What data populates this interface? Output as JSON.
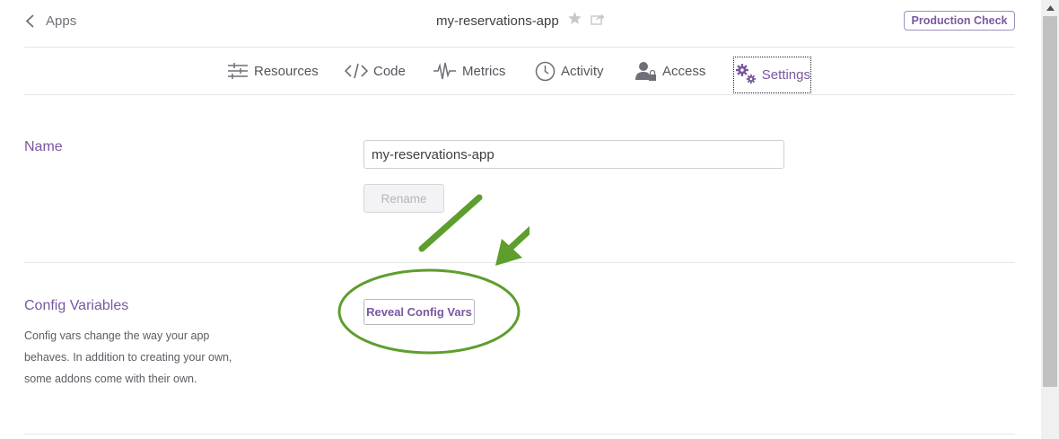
{
  "header": {
    "back_label": "Apps",
    "app_title": "my-reservations-app",
    "star_icon": "star-icon",
    "share_icon": "share-icon",
    "production_check_label": "Production Check"
  },
  "tabs": [
    {
      "label": "Resources",
      "icon": "resources-sliders-icon"
    },
    {
      "label": "Code",
      "icon": "code-icon"
    },
    {
      "label": "Metrics",
      "icon": "metrics-pulse-icon"
    },
    {
      "label": "Activity",
      "icon": "clock-icon"
    },
    {
      "label": "Access",
      "icon": "user-lock-icon"
    },
    {
      "label": "Settings",
      "icon": "gears-icon",
      "active": true
    }
  ],
  "name_section": {
    "label": "Name",
    "input_value": "my-reservations-app",
    "rename_label": "Rename"
  },
  "config_section": {
    "label": "Config Variables",
    "description": "Config vars change the way your app behaves. In addition to creating your own, some addons come with their own.",
    "reveal_label": "Reveal Config Vars"
  },
  "colors": {
    "accent": "#79589f",
    "annotation": "#5d9e2c",
    "divider": "#e6e6e9"
  }
}
